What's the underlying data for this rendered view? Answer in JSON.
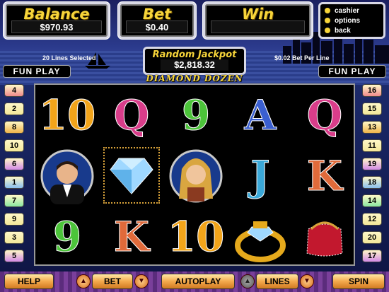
{
  "top": {
    "balance": {
      "label": "Balance",
      "value": "$970.93"
    },
    "bet": {
      "label": "Bet",
      "value": "$0.40"
    },
    "win": {
      "label": "Win",
      "value": ""
    }
  },
  "menu": [
    "cashier",
    "options",
    "back"
  ],
  "lines_selected": "20 Lines Selected",
  "bet_per_line": "$0.02 Bet Per Line",
  "jackpot": {
    "label": "Random Jackpot",
    "value": "$2,818.32"
  },
  "fun_play": "FUN PLAY",
  "logo": "DIAMOND DOZEN",
  "reels": [
    [
      "10",
      "man",
      "9"
    ],
    [
      "Q",
      "diamond",
      "K"
    ],
    [
      "9",
      "woman",
      "10"
    ],
    [
      "A",
      "J",
      "ring"
    ],
    [
      "Q",
      "K",
      "purse"
    ]
  ],
  "left_lines": [
    "4",
    "2",
    "8",
    "10",
    "6",
    "1",
    "7",
    "9",
    "3",
    "5"
  ],
  "right_lines": [
    "16",
    "15",
    "13",
    "11",
    "19",
    "18",
    "14",
    "12",
    "20",
    "17"
  ],
  "bottom": {
    "help": "HELP",
    "bet": "BET",
    "autoplay": "AUTOPLAY",
    "lines": "LINES",
    "spin": "SPIN"
  }
}
